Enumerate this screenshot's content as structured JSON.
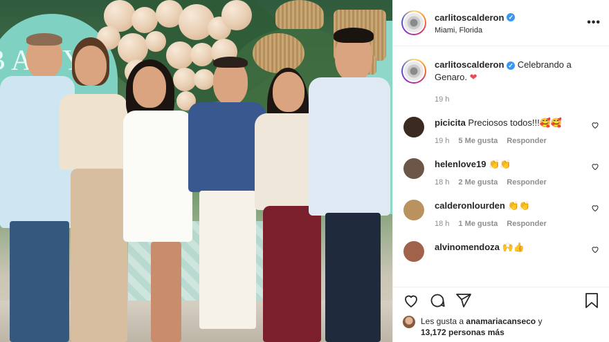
{
  "post": {
    "author": "carlitoscalderon",
    "location": "Miami, Florida",
    "verified_mark": "✓",
    "more_label": "•••",
    "photo_sign_text": "BABY"
  },
  "caption": {
    "user": "carlitoscalderon",
    "text": "Celebrando a Genaro.",
    "emoji": "❤",
    "time": "19 h"
  },
  "comments": [
    {
      "user": "picicita",
      "text": "Preciosos todos!!!🥰🥰",
      "time": "19 h",
      "likes": "5 Me gusta",
      "reply": "Responder",
      "avatar_color": "#3a2a1f"
    },
    {
      "user": "helenlove19",
      "text": "👏👏",
      "time": "18 h",
      "likes": "2 Me gusta",
      "reply": "Responder",
      "avatar_color": "#6b5647"
    },
    {
      "user": "calderonlourden",
      "text": "👏👏",
      "time": "18 h",
      "likes": "1 Me gusta",
      "reply": "Responder",
      "avatar_color": "#b9925f"
    },
    {
      "user": "alvinomendoza",
      "text": "🙌👍",
      "time": "",
      "likes": "",
      "reply": "",
      "avatar_color": "#a0624a"
    }
  ],
  "likes_line": {
    "prefix": "Les gusta a",
    "user": "anamariacanseco",
    "suffix": "y",
    "count": "13,172 personas más"
  },
  "icons": {
    "like": "heart-icon",
    "comment": "comment-icon",
    "share": "share-icon",
    "save": "bookmark-icon",
    "comment_like": "heart-outline-icon"
  },
  "colors": {
    "accent": "#3897f0",
    "heart": "#ed4956",
    "muted": "#8e8e8e"
  }
}
